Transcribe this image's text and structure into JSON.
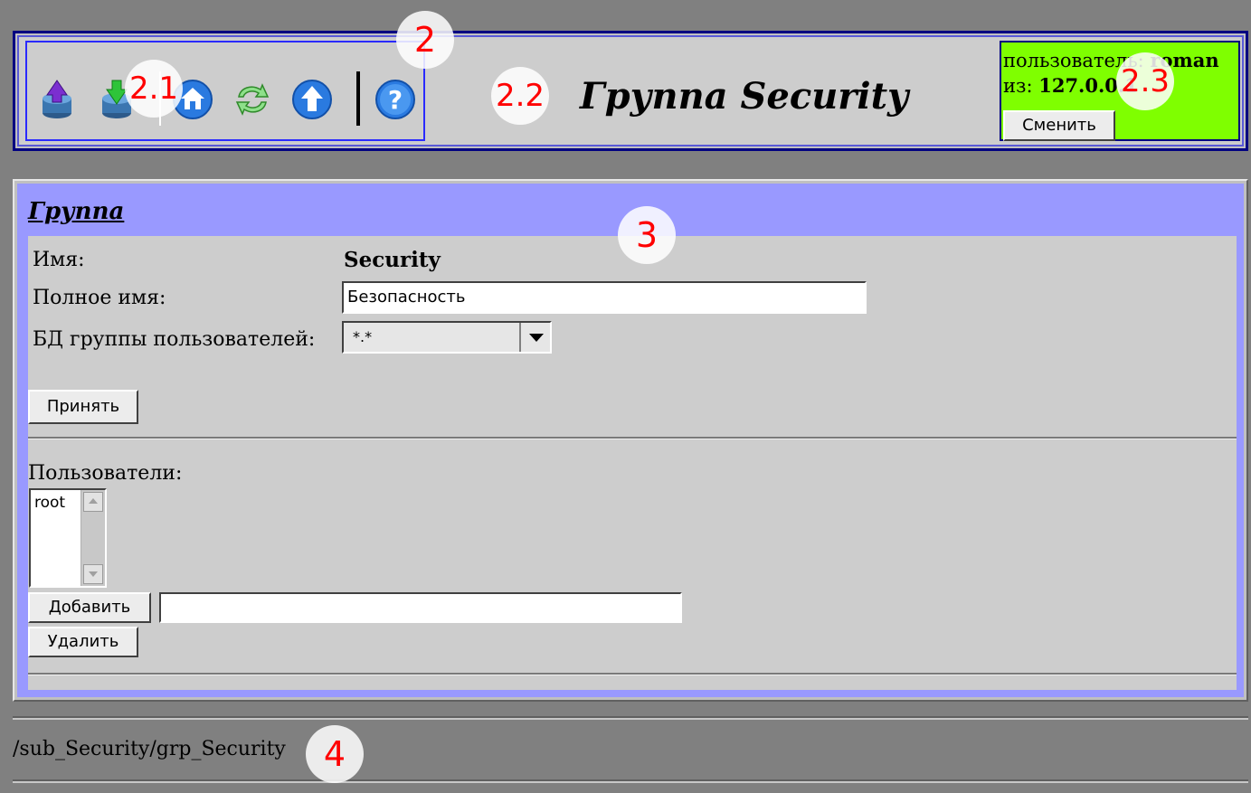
{
  "header": {
    "title": "Группа Security",
    "toolbar": {
      "icons": [
        "db-upload-icon",
        "db-download-icon",
        "home-icon",
        "refresh-icon",
        "up-icon",
        "help-icon"
      ]
    },
    "user": {
      "user_label": "пользователь:",
      "user_name": "roman",
      "from_label": "из:",
      "from_addr": "127.0.0.1",
      "change_button": "Сменить",
      "bg_color": "#7fff00"
    }
  },
  "panel": {
    "title": "Группа",
    "name_label": "Имя:",
    "name_value": "Security",
    "fullname_label": "Полное имя:",
    "fullname_value": "Безопасность",
    "db_label": "БД группы пользователей:",
    "db_value": "*.*",
    "accept_button": "Принять",
    "users_label": "Пользователи:",
    "users": [
      "root"
    ],
    "add_button": "Добавить",
    "add_input_value": "",
    "delete_button": "Удалить"
  },
  "footer": {
    "path": "/sub_Security/grp_Security"
  },
  "annotations": {
    "m2": "2",
    "m21": "2.1",
    "m22": "2.2",
    "m23": "2.3",
    "m3": "3",
    "m4": "4"
  }
}
